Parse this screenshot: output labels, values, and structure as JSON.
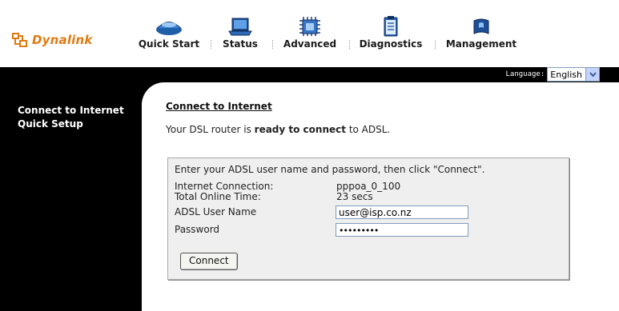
{
  "brand": {
    "name": "Dynalink",
    "color": "#e07a10"
  },
  "nav": [
    {
      "label": "Quick Start",
      "icon": "modem-icon"
    },
    {
      "label": "Status",
      "icon": "laptop-icon"
    },
    {
      "label": "Advanced",
      "icon": "chip-icon"
    },
    {
      "label": "Diagnostics",
      "icon": "clipboard-icon"
    },
    {
      "label": "Management",
      "icon": "wrench-icon"
    }
  ],
  "language": {
    "label": "Language:",
    "value": "English"
  },
  "sidebar": {
    "items": [
      {
        "label": "Connect to Internet"
      },
      {
        "label": "Quick Setup"
      }
    ]
  },
  "main": {
    "title": "Connect to Internet",
    "status_prefix": "Your DSL router is ",
    "status_bold": "ready to connect",
    "status_suffix": " to ADSL.",
    "intro": "Enter your ADSL user name and password, then click \"Connect\".",
    "rows": [
      {
        "label": "Internet Connection:",
        "value": "pppoa_0_100"
      },
      {
        "label": "Total Online Time:",
        "value": "23 secs"
      }
    ],
    "username": {
      "label": "ADSL User Name",
      "value": "user@isp.co.nz"
    },
    "password": {
      "label": "Password",
      "value": "•••••••••"
    },
    "connect_button": "Connect"
  }
}
